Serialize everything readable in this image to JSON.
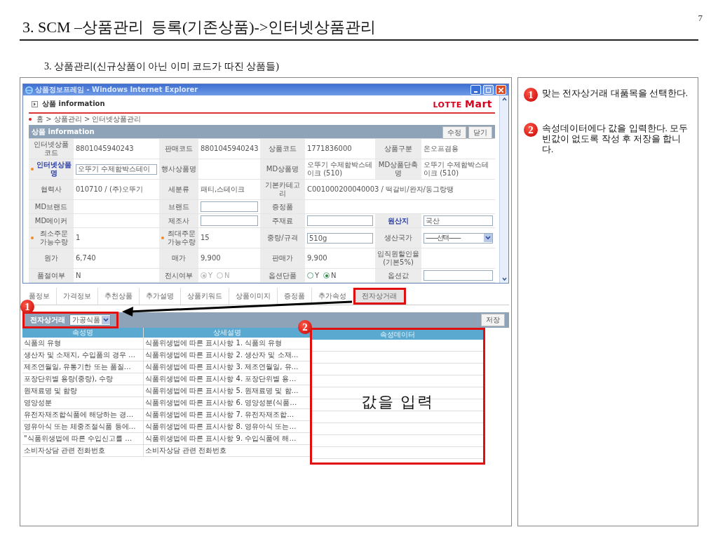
{
  "slide": {
    "title": "3. SCM –상품관리  등록(기존상품)->인터넷상품관리",
    "page": "7",
    "subtitle": "3. 상품관리(신규상품이 아닌 이미 코드가 따진 상품들)"
  },
  "window": {
    "title": "상품정보프레임 - Windows Internet Explorer",
    "header": "상품 information",
    "logo": "LOTTE **Mart**",
    "breadcrumb": "홈 > 상품관리 > 인터넷상품관리"
  },
  "section": {
    "title": "상품 information",
    "buttons": [
      "수정",
      "닫기"
    ]
  },
  "grid": [
    {
      "cells": [
        {
          "kind": "label",
          "text": "인터넷상품코드"
        },
        {
          "kind": "text",
          "text": "8801045940243"
        },
        {
          "kind": "label",
          "text": "판매코드"
        },
        {
          "kind": "text",
          "text": "8801045940243"
        },
        {
          "kind": "label",
          "text": "상품코드"
        },
        {
          "kind": "text",
          "text": "1771836000"
        },
        {
          "kind": "label",
          "text": "상품구분"
        },
        {
          "kind": "text",
          "text": "온오프겸용"
        }
      ]
    },
    {
      "cells": [
        {
          "kind": "label",
          "text": "인터넷상품명",
          "required": true,
          "emphasis": true
        },
        {
          "kind": "input",
          "value": "오뚜기 수제함박스테이"
        },
        {
          "kind": "label",
          "text": "행사상품명"
        },
        {
          "kind": "empty"
        },
        {
          "kind": "label",
          "text": "MD상품명"
        },
        {
          "kind": "text",
          "text": "오뚜기 수제함박스테이크 (510)"
        },
        {
          "kind": "label",
          "text": "MD상품단축명"
        },
        {
          "kind": "text",
          "text": "오뚜기 수제함박스테이크 (510)"
        }
      ]
    },
    {
      "cells": [
        {
          "kind": "label",
          "text": "협력사"
        },
        {
          "kind": "text",
          "text": "010710 / (주)오뚜기"
        },
        {
          "kind": "label",
          "text": "세분류"
        },
        {
          "kind": "text",
          "text": "패티,스테이크"
        },
        {
          "kind": "label",
          "text": "기본카테고리"
        },
        {
          "kind": "text",
          "text": "C001000200040003 / 떡갈비/완자/동그랑땡",
          "wide": true
        }
      ]
    },
    {
      "cells": [
        {
          "kind": "label",
          "text": "MD브랜드"
        },
        {
          "kind": "empty"
        },
        {
          "kind": "label",
          "text": "브랜드"
        },
        {
          "kind": "input"
        },
        {
          "kind": "label",
          "text": "증정품"
        },
        {
          "kind": "empty",
          "wide": true
        }
      ]
    },
    {
      "cells": [
        {
          "kind": "label",
          "text": "MD메이커"
        },
        {
          "kind": "empty"
        },
        {
          "kind": "label",
          "text": "제조사"
        },
        {
          "kind": "input"
        },
        {
          "kind": "label",
          "text": "주재료"
        },
        {
          "kind": "input"
        },
        {
          "kind": "label",
          "text": "원산지",
          "emphasis": true
        },
        {
          "kind": "input",
          "value": "국산"
        }
      ]
    },
    {
      "cells": [
        {
          "kind": "label",
          "text": "최소주문 가능수량",
          "required": true
        },
        {
          "kind": "text",
          "text": "1"
        },
        {
          "kind": "label",
          "text": "최대주문 가능수량",
          "required": true
        },
        {
          "kind": "text",
          "text": "15"
        },
        {
          "kind": "label",
          "text": "중량/규격"
        },
        {
          "kind": "input",
          "value": "510g"
        },
        {
          "kind": "label",
          "text": "생산국가"
        },
        {
          "kind": "select",
          "value": "---------선택---------"
        }
      ]
    },
    {
      "cells": [
        {
          "kind": "label",
          "text": "원가"
        },
        {
          "kind": "text",
          "text": "6,740"
        },
        {
          "kind": "label",
          "text": "매가"
        },
        {
          "kind": "text",
          "text": "9,900"
        },
        {
          "kind": "label",
          "text": "판매가"
        },
        {
          "kind": "text",
          "text": "9,900"
        },
        {
          "kind": "label",
          "text": "임직원할인율 (기본5%)"
        },
        {
          "kind": "empty"
        }
      ]
    },
    {
      "cells": [
        {
          "kind": "label",
          "text": "품절여부"
        },
        {
          "kind": "text",
          "text": "N"
        },
        {
          "kind": "label",
          "text": "전시여부"
        },
        {
          "kind": "radio",
          "disabled": true,
          "options": [
            {
              "label": "Y",
              "selected": true
            },
            {
              "label": "N",
              "selected": false
            }
          ]
        },
        {
          "kind": "label",
          "text": "옵션단품"
        },
        {
          "kind": "radio",
          "disabled": false,
          "options": [
            {
              "label": "Y",
              "selected": false
            },
            {
              "label": "N",
              "selected": true
            }
          ]
        },
        {
          "kind": "label",
          "text": "옵션값"
        },
        {
          "kind": "input"
        }
      ]
    }
  ],
  "tabs": [
    {
      "label": "품정보",
      "selected": false,
      "boxed": false
    },
    {
      "label": "가격정보",
      "selected": false,
      "boxed": false
    },
    {
      "label": "추천상품",
      "selected": false,
      "boxed": false
    },
    {
      "label": "추가설명",
      "selected": false,
      "boxed": false
    },
    {
      "label": "상품키워드",
      "selected": false,
      "boxed": false
    },
    {
      "label": "상품이미지",
      "selected": false,
      "boxed": false
    },
    {
      "label": "증정품",
      "selected": false,
      "boxed": false
    },
    {
      "label": "추가속성",
      "selected": false,
      "boxed": false
    },
    {
      "label": "전자상거래",
      "selected": true,
      "boxed": true
    }
  ],
  "ecommerce": {
    "title": "전자상거래",
    "category": "가공식품",
    "boxed": true,
    "badge": "1",
    "save": "저장"
  },
  "table": {
    "columns": [
      {
        "label": "속성명",
        "boxed": false
      },
      {
        "label": "상세설명",
        "boxed": false
      },
      {
        "label": "속성데이터",
        "boxed": true,
        "badge": "2",
        "overlay": "값을 입력"
      }
    ],
    "rows": [
      [
        "식품의 유형",
        "식품위생법에 따른 표시사항 1. 식품의 유형"
      ],
      [
        "생산자 및 소재지, 수입품의 경우 …",
        "식품위생법에 따른 표시사항 2. 생산자 및 소재…"
      ],
      [
        "제조연월일, 유통기한 또는 품질…",
        "식품위생법에 따른 표시사항 3. 제조연월일, 유…"
      ],
      [
        "포장단위별 용량(중량), 수량",
        "식품위생법에 따른 표시사항 4. 포장단위별 용…"
      ],
      [
        "원재료명 및 함량",
        "식품위생법에 따른 표시사항 5. 원재료명 및 함…"
      ],
      [
        "영양성분",
        "식품위생법에 따른 표시사항 6. 영양성분(식품…"
      ],
      [
        "유전자재조합식품에 해당하는 경…",
        "식품위생법에 따른 표시사항 7. 유전자재조합…"
      ],
      [
        "영유아식 또는 체중조절식품 등에…",
        "식품위생법에 따른 표시사항 8. 영유아식 또는…"
      ],
      [
        "\"식품위생법에 따른 수입신고를 …",
        "식품위생법에 따른 표시사항 9. 수입식품에 해…"
      ],
      [
        "소비자상담 관련 전화번호",
        "소비자상담 관련 전화번호"
      ]
    ]
  },
  "notes": [
    {
      "badge": "1",
      "text": "맞는 전자상거래 대품목을 선택한다."
    },
    {
      "badge": "2",
      "text": "속성데이터에다 값을 입력한다. 모두 빈값이 없도록 작성 후 저장을 합니다."
    }
  ]
}
